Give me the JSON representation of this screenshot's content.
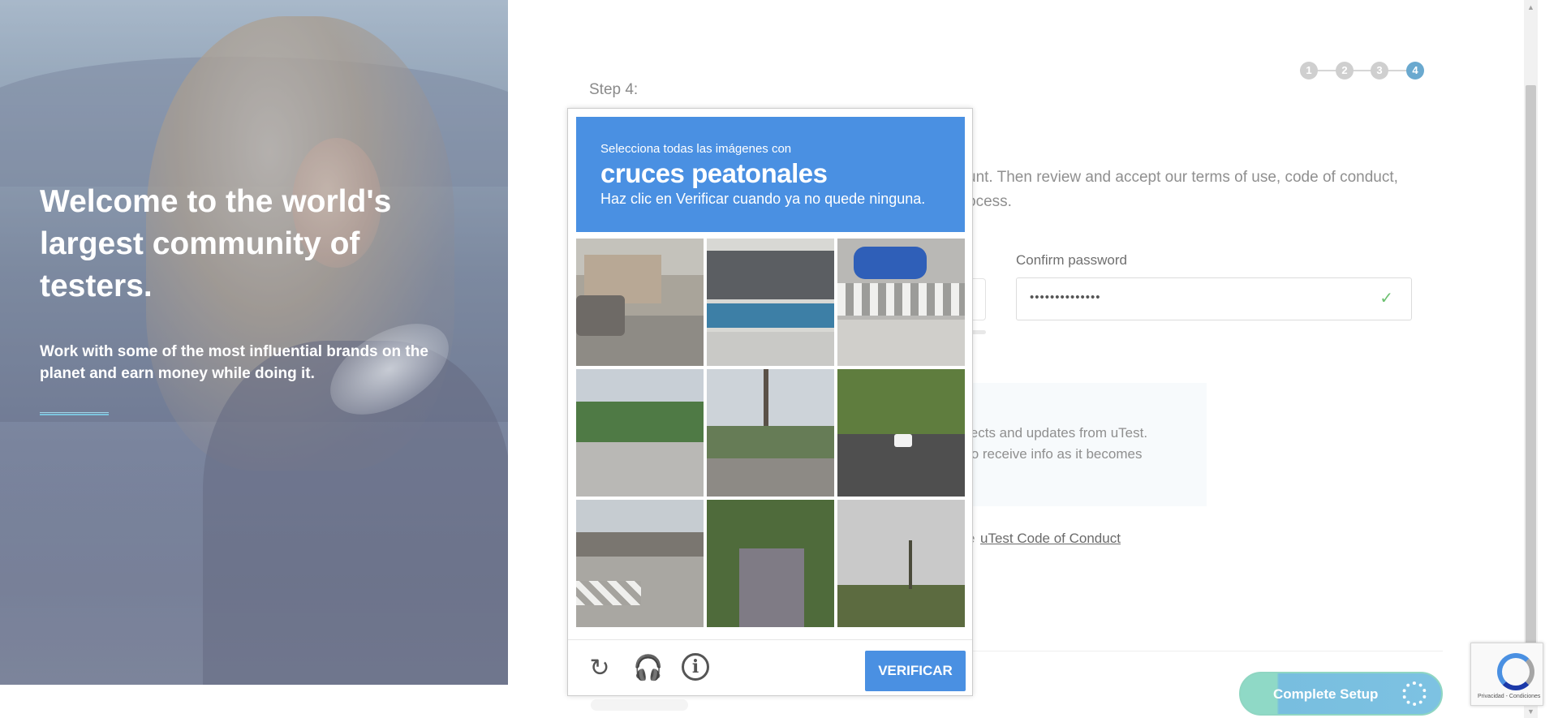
{
  "hero": {
    "title": "Welcome to the world's largest community of testers.",
    "subtitle": "Work with some of the most influential brands on the planet and earn money while doing it."
  },
  "steps": {
    "items": [
      "1",
      "2",
      "3",
      "4"
    ],
    "active": "4",
    "label": "Step 4:"
  },
  "form": {
    "intro_line1": "unt. Then review and accept our terms of use, code of conduct,",
    "intro_line2": "ocess.",
    "confirm_password_label": "Confirm password",
    "confirm_password_value": "••••••••••••••",
    "newsletter_line1": "jects and updates from uTest.",
    "newsletter_line2": "to receive info as it becomes",
    "coc_prefix": "e",
    "coc_link": "uTest Code of Conduct",
    "complete_button": "Complete Setup"
  },
  "captcha": {
    "instruction_line1": "Selecciona todas las imágenes con",
    "target": "cruces peatonales",
    "instruction_line3": "Haz clic en Verificar cuando ya no quede ninguna.",
    "verify_label": "VERIFICAR",
    "reload_icon": "reload-icon",
    "audio_icon": "headphones-icon",
    "info_icon": "info-icon",
    "header_color": "#4a90e2",
    "tiles": [
      "street-house-crosswalk",
      "bus-side",
      "blue-car-crosswalk",
      "palm-trees-street",
      "power-lines-traffic",
      "car-curved-road",
      "parking-lot-crosswalk",
      "tree-lined-street",
      "palm-tree-field"
    ]
  },
  "recaptcha_badge": {
    "terms": "Privacidad - Condiciones"
  },
  "colors": {
    "accent": "#6aa9cf",
    "complete_button": "#7dc2e2",
    "check": "#6cc070"
  }
}
